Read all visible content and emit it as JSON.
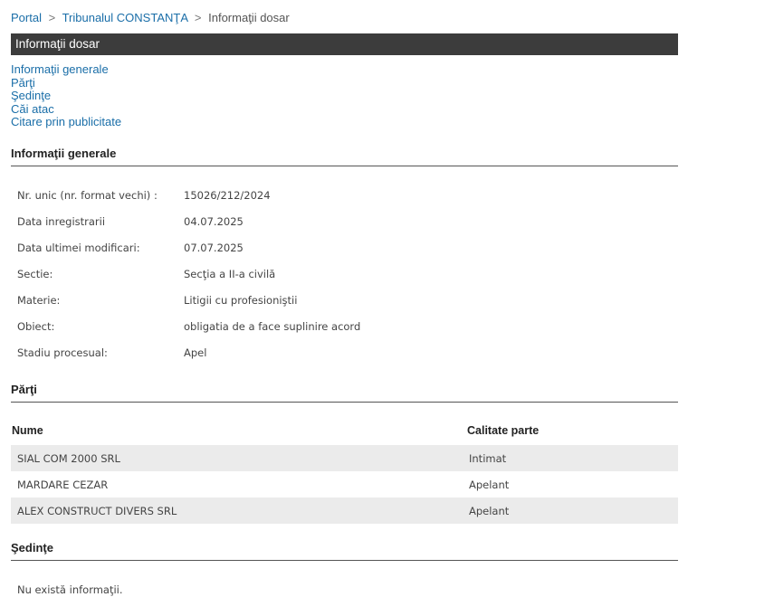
{
  "breadcrumb": {
    "items": [
      "Portal",
      "Tribunalul CONSTANŢA"
    ],
    "current": "Informaţii dosar",
    "separator": ">"
  },
  "title": "Informaţii dosar",
  "toc": [
    "Informaţii generale",
    "Părţi",
    "Şedinţe",
    "Căi atac",
    "Citare prin publicitate"
  ],
  "general": {
    "heading": "Informaţii generale",
    "rows": [
      {
        "label": "Nr. unic (nr. format vechi) :",
        "value": "15026/212/2024"
      },
      {
        "label": "Data inregistrarii",
        "value": "04.07.2025"
      },
      {
        "label": "Data ultimei modificari:",
        "value": "07.07.2025"
      },
      {
        "label": "Sectie:",
        "value": "Secţia a II-a civilă"
      },
      {
        "label": "Materie:",
        "value": "Litigii cu profesioniştii"
      },
      {
        "label": "Obiect:",
        "value": "obligatia de a face suplinire acord"
      },
      {
        "label": "Stadiu procesual:",
        "value": "Apel"
      }
    ]
  },
  "parti": {
    "heading": "Părţi",
    "columns": [
      "Nume",
      "Calitate parte"
    ],
    "rows": [
      {
        "nume": "SIAL COM 2000 SRL",
        "calitate": "Intimat"
      },
      {
        "nume": "MARDARE CEZAR",
        "calitate": "Apelant"
      },
      {
        "nume": "ALEX CONSTRUCT DIVERS SRL",
        "calitate": "Apelant"
      }
    ]
  },
  "sedinte": {
    "heading": "Şedinţe",
    "empty_text": "Nu există informaţii."
  },
  "colors": {
    "link": "#1a6ea8",
    "titlebar_bg": "#3c3c3c",
    "row_alt_bg": "#ebebeb"
  }
}
